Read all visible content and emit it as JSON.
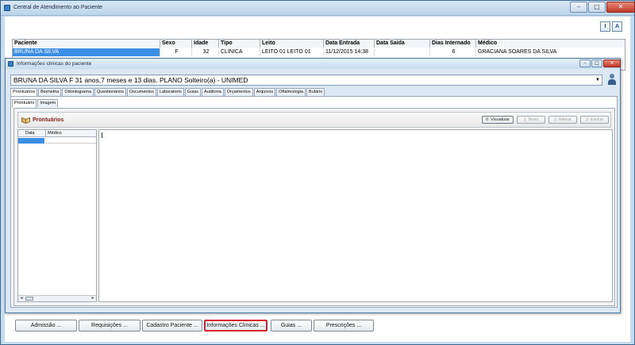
{
  "outer_window": {
    "title": "Central de Atendimento ao Paciente",
    "controls": {
      "minimize": "–",
      "maximize": "□",
      "close": "✕"
    },
    "toolbar": {
      "btn_i": "I",
      "btn_a": "A"
    }
  },
  "patients_grid": {
    "columns": [
      "Paciente",
      "Sexo",
      "Idade",
      "Tipo",
      "Leito",
      "Data Entrada",
      "Data Saida",
      "Dias Internado",
      "Médico"
    ],
    "rows": [
      [
        "BRUNA DA SILVA",
        "F",
        "32",
        "CLÍNICA",
        "LEITO 01 LEITO 01",
        "11/12/2015 14:38",
        "",
        "6",
        "GRACIANA SOARES DA SILVA"
      ]
    ]
  },
  "inner_window": {
    "title": "Informações clinicas do paciente",
    "controls": {
      "minimize": "–",
      "maximize": "□",
      "close": "✕"
    },
    "patient_summary": "BRUNA DA SILVA F 31 anos,7 meses e 13 dias.  PLANO Solteiro(a) - UNIMED",
    "combo_arrow": "▼",
    "main_tabs": [
      "Prontuários",
      "Biometria",
      "Odontograma",
      "Questionários",
      "Documentos",
      "Laboratorio",
      "Guias",
      "Auditoria",
      "Orçamentos",
      "Arquivos",
      "Oftalmologia",
      "Bulário"
    ],
    "sub_tabs": [
      "Prontuário",
      "Imagem"
    ],
    "section_title": "Prontuários",
    "actions": {
      "visualizar": "0. Visualizar",
      "novo": "1. Novo",
      "alterar": "2. Alterar",
      "excluir": "3. Excluir"
    },
    "list_columns": {
      "data": "Data",
      "medico": "Médico"
    },
    "scroll": {
      "left": "◄",
      "right": "►"
    }
  },
  "bottom_buttons": {
    "admissao": "Admissão ...",
    "requisicoes": "Requisições ...",
    "cadastro": "Cadastro Paciente ...",
    "informacoes": "Informações Clínicas ...",
    "guias": "Guias ...",
    "prescricoes": "Prescrições ..."
  },
  "colors": {
    "selection": "#3a8ee6",
    "highlight_border": "#d8202a",
    "section_title": "#8a1c1c"
  }
}
